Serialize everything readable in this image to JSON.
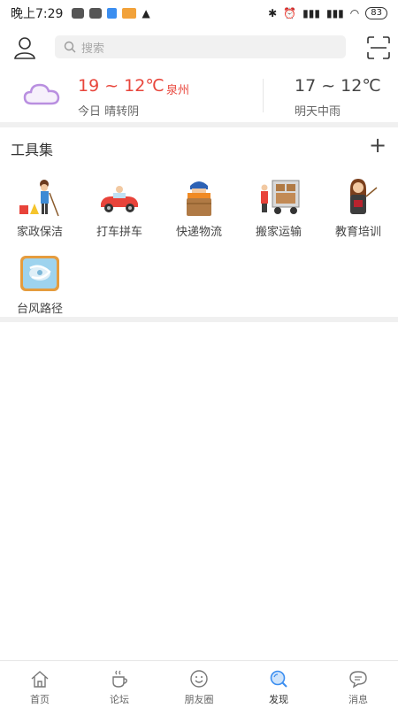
{
  "status_bar": {
    "time": "晚上7:29",
    "battery": "83"
  },
  "header": {
    "search_placeholder": "搜索"
  },
  "weather": {
    "today_temp": "19 ~ 12℃",
    "city": "泉州",
    "today_desc": "今日 晴转阴",
    "tomorrow_temp": "17 ~ 12℃",
    "tomorrow_desc": "明天中雨",
    "icon": "cloud-icon",
    "colors": {
      "today": "#e8463c",
      "cloud": "#b98fe0"
    }
  },
  "tools": {
    "title": "工具集",
    "add_label": "+",
    "items": [
      {
        "label": "家政保洁",
        "icon": "cleaning-icon"
      },
      {
        "label": "打车拼车",
        "icon": "car-icon"
      },
      {
        "label": "快递物流",
        "icon": "courier-icon"
      },
      {
        "label": "搬家运输",
        "icon": "moving-truck-icon"
      },
      {
        "label": "教育培训",
        "icon": "teacher-icon"
      },
      {
        "label": "台风路径",
        "icon": "typhoon-icon"
      }
    ]
  },
  "bottom_nav": {
    "items": [
      {
        "label": "首页",
        "icon": "home-icon"
      },
      {
        "label": "论坛",
        "icon": "coffee-icon"
      },
      {
        "label": "朋友圈",
        "icon": "smile-icon"
      },
      {
        "label": "发现",
        "icon": "discover-icon"
      },
      {
        "label": "消息",
        "icon": "message-icon"
      }
    ],
    "active_index": 3,
    "active_color": "#3b8ef0"
  }
}
